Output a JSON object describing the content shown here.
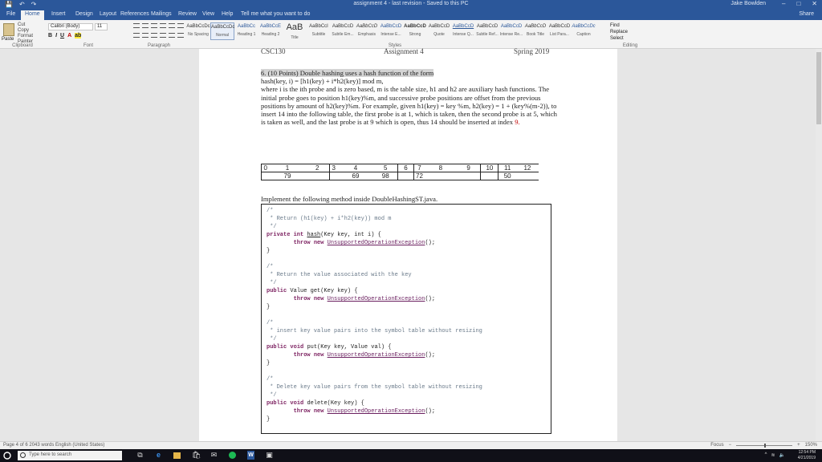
{
  "titlebar": {
    "title": "assignment 4 - last revision - Saved to this PC",
    "user": "Jake Bowlden",
    "minimize": "–",
    "maximize": "□",
    "close": "✕",
    "quick_save": "💾",
    "quick_undo": "↶",
    "quick_redo": "↷"
  },
  "menu": {
    "tabs": [
      "File",
      "Home",
      "Insert",
      "Design",
      "Layout",
      "References",
      "Mailings",
      "Review",
      "View",
      "Help",
      "Tell me what you want to do"
    ],
    "share": "Share"
  },
  "ribbon": {
    "clipboard": {
      "paste": "Paste",
      "cut": "Cut",
      "copy": "Copy",
      "format_painter": "Format Painter",
      "label": "Clipboard"
    },
    "font": {
      "name": "Calibri (Body)",
      "size": "11",
      "bold": "B",
      "italic": "I",
      "underline": "U",
      "label": "Font"
    },
    "paragraph": {
      "label": "Paragraph"
    },
    "styles": {
      "label": "Styles",
      "items": [
        {
          "sample": "AaBbCcDc",
          "name": "No Spacing"
        },
        {
          "sample": "AaBbCcDc",
          "name": "Normal"
        },
        {
          "sample": "AaBbCc",
          "name": "Heading 1"
        },
        {
          "sample": "AaBbCcE",
          "name": "Heading 2"
        },
        {
          "sample": "AaB",
          "name": "Title"
        },
        {
          "sample": "AaBbCcI",
          "name": "Subtitle"
        },
        {
          "sample": "AaBbCcD",
          "name": "Subtle Em..."
        },
        {
          "sample": "AaBbCcD",
          "name": "Emphasis"
        },
        {
          "sample": "AaBbCcD",
          "name": "Intense E..."
        },
        {
          "sample": "AaBbCcD",
          "name": "Strong"
        },
        {
          "sample": "AaBbCcD",
          "name": "Quote"
        },
        {
          "sample": "AaBbCcD",
          "name": "Intense Q..."
        },
        {
          "sample": "AaBbCcD",
          "name": "Subtle Ref..."
        },
        {
          "sample": "AaBbCcD",
          "name": "Intense Re..."
        },
        {
          "sample": "AaBbCcD",
          "name": "Book Title"
        },
        {
          "sample": "AaBbCcD",
          "name": "List Para..."
        },
        {
          "sample": "AaBbCcDc",
          "name": "Caption"
        }
      ]
    },
    "editing": {
      "find": "Find",
      "replace": "Replace",
      "select": "Select",
      "label": "Editing"
    }
  },
  "document": {
    "header_left": "CSC130",
    "header_center": "Assignment 4",
    "header_right": "Spring 2019",
    "question_title": "6. (10 Points) Double hashing uses a hash function of the form",
    "formula": "hash(key, i) = [h1(key) + i*h2(key)] mod m,",
    "body": "where i is the ith probe and is zero based, m is the table size, h1 and h2 are auxiliary hash functions. The initial probe goes to position h1(key)%m, and successive probe positions are offset from the previous positions by amount of h2(key)%m. For example, given h1(key) = key %m, h2(key) = 1 + (key%(m-2)), to insert 14 into the following table, the first probe is at 1, which is taken, then the second probe is at 5, which is taken as well, and the last probe is at 9 which is open, thus 14 should be inserted at index",
    "answer_index": "9",
    "answer_period": ".",
    "table_indices": [
      "0",
      "1",
      "2",
      "3",
      "4",
      "5",
      "6",
      "7",
      "8",
      "9",
      "10",
      "11",
      "12"
    ],
    "table_values": [
      "",
      "79",
      "",
      "",
      "69",
      "98",
      "",
      "72",
      "",
      "",
      "",
      "50",
      ""
    ],
    "implement_text": "Implement the following method inside DoubleHashingST.java.",
    "code": {
      "c1_open": "/*",
      "c1_text": " * Return (h1(key) + i*h2(key)) mod m",
      "c1_close": " */",
      "m1_mod": "private",
      "m1_type": "int",
      "m1_name": "hash",
      "m1_args": "(Key key, int i) {",
      "throw_kw": "throw",
      "new_kw": "new",
      "exc": "UnsupportedOperationException",
      "exc_end": "();",
      "brace": "}",
      "c2_text": " * Return the value associated with the key",
      "m2_mod": "public",
      "m2_sig": "Value get(Key key) {",
      "c3_text": " * insert key value pairs into the symbol table without resizing",
      "m3_mod": "public",
      "m3_type": "void",
      "m3_sig": "put(Key key, Value val) {",
      "c4_text": " * Delete key value pairs from the symbol table without resizing",
      "m4_mod": "public",
      "m4_type": "void",
      "m4_sig": "delete(Key key) {"
    }
  },
  "statusbar": {
    "page": "Page 4 of 6   2043 words   English (United States)",
    "view_modes": "Focus",
    "zoom": "150%"
  },
  "taskbar": {
    "search_placeholder": "Type here to search",
    "time": "12:54 PM",
    "date": "4/21/2019",
    "icons": [
      "task-view",
      "edge",
      "file-explorer",
      "store",
      "mail",
      "spotify",
      "word",
      "photos"
    ]
  },
  "colors": {
    "word_blue": "#2b579a",
    "keyword": "#7b1f5f",
    "comment": "#6a7a8a",
    "highlight": "#d4d4d4",
    "answer_red": "#c00000"
  }
}
